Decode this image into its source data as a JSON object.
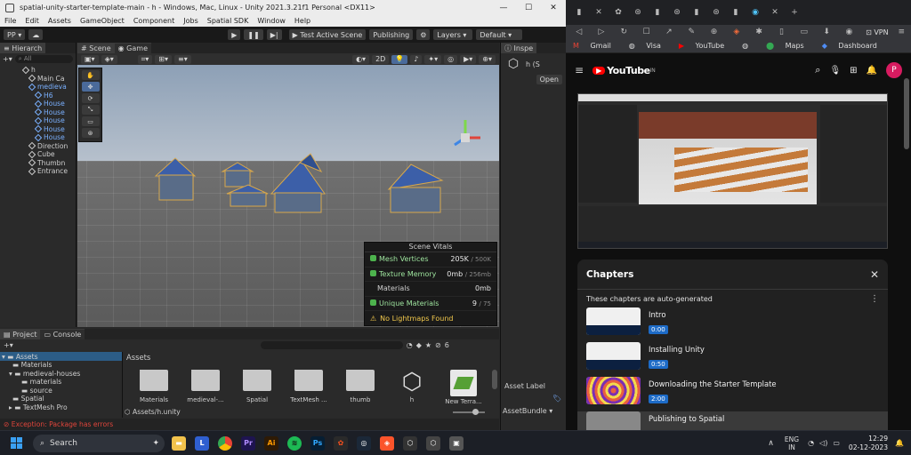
{
  "unity": {
    "title": "spatial-unity-starter-template-main - h - Windows, Mac, Linux - Unity 2021.3.21f1 Personal <DX11>",
    "menu": [
      "File",
      "Edit",
      "Assets",
      "GameObject",
      "Component",
      "Jobs",
      "Spatial SDK",
      "Window",
      "Help"
    ],
    "toolbar": {
      "account": "PP",
      "test_scene": "Test Active Scene",
      "publishing": "Publishing",
      "layers": "Layers",
      "layout": "Default"
    },
    "hierarchy": {
      "tab": "Hierarch",
      "search": "All",
      "items": [
        {
          "label": "h",
          "blue": false
        },
        {
          "label": "Main Ca",
          "blue": false
        },
        {
          "label": "medieva",
          "blue": true
        },
        {
          "label": "H6",
          "blue": true
        },
        {
          "label": "House",
          "blue": true
        },
        {
          "label": "House",
          "blue": true
        },
        {
          "label": "House",
          "blue": true
        },
        {
          "label": "House",
          "blue": true
        },
        {
          "label": "House",
          "blue": true
        },
        {
          "label": "Direction",
          "blue": false
        },
        {
          "label": "Cube",
          "blue": false
        },
        {
          "label": "Thumbn",
          "blue": false
        },
        {
          "label": "Entrance",
          "blue": false
        }
      ]
    },
    "scene": {
      "tab_scene": "Scene",
      "tab_game": "Game",
      "mode_2d": "2D",
      "vitals": {
        "title": "Scene Vitals",
        "rows": [
          {
            "label": "Mesh Vertices",
            "value": "205K",
            "max": "/ 500K"
          },
          {
            "label": "Texture Memory",
            "value": "0mb",
            "max": "/ 256mb"
          },
          {
            "label": "Materials",
            "value": "0mb",
            "max": ""
          },
          {
            "label": "Unique Materials",
            "value": "9",
            "max": "/ 75"
          }
        ],
        "warning": "No Lightmaps Found"
      }
    },
    "inspector": {
      "tab": "Inspe",
      "name": "h (S",
      "open": "Open",
      "asset_labels": "Asset Label",
      "asset_bundle": "AssetBundle"
    },
    "project": {
      "tab_project": "Project",
      "tab_console": "Console",
      "badge": "6",
      "tree": [
        "Assets",
        "Materials",
        "medieval-houses",
        "materials",
        "source",
        "Spatial",
        "TextMesh Pro"
      ],
      "breadcrumb": "Assets",
      "assets": [
        "Materials",
        "medieval-...",
        "Spatial",
        "TextMesh ...",
        "thumb",
        "h",
        "New Terra..."
      ],
      "path": "Assets/h.unity",
      "error": "Exception: Package has errors"
    }
  },
  "chrome": {
    "bookmarks": [
      "Gmail",
      "Visa",
      "YouTube",
      "Maps",
      "Dashboard"
    ],
    "vpn": "VPN",
    "avatar": "P",
    "youtube_logo": "YouTube",
    "region": "IN",
    "chapters": {
      "title": "Chapters",
      "subtitle": "These chapters are auto-generated",
      "items": [
        {
          "title": "Intro",
          "time": "0:00"
        },
        {
          "title": "Installing Unity",
          "time": "0:50"
        },
        {
          "title": "Downloading the Starter Template",
          "time": "2:00"
        },
        {
          "title": "Publishing to Spatial",
          "time": ""
        }
      ]
    }
  },
  "taskbar": {
    "search": "Search",
    "lang1": "ENG",
    "lang2": "IN",
    "time": "12:29",
    "date": "02-12-2023"
  }
}
